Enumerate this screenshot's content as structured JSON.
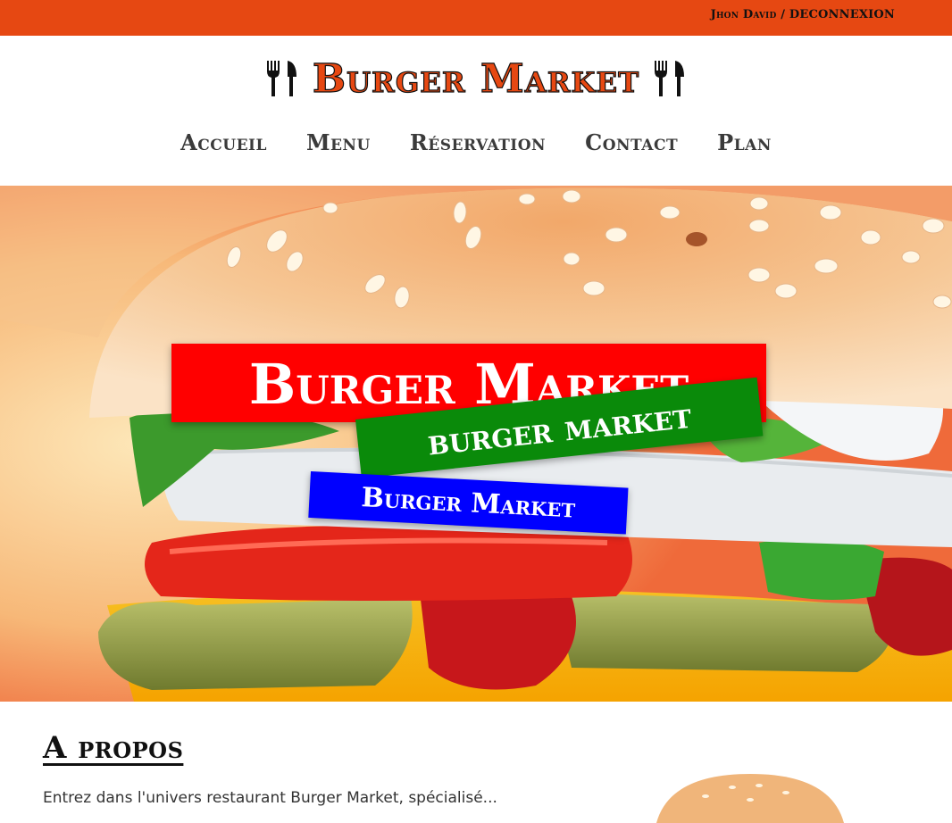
{
  "topbar": {
    "user_name": "Jhon David",
    "separator": " / ",
    "logout_label": "DECONNEXION",
    "color": "#e64812"
  },
  "header": {
    "logo_text": "Burger Market",
    "logo_icon": "cutlery-icon",
    "nav": [
      "Accueil",
      "Menu",
      "Réservation",
      "Contact",
      "Plan"
    ]
  },
  "hero": {
    "banners": [
      {
        "text": "Burger Market",
        "color": "#ff0000"
      },
      {
        "text": "burger market",
        "color": "#0a8a0a"
      },
      {
        "text": "Burger Market",
        "color": "#0000ff"
      }
    ]
  },
  "about": {
    "title": "A propos",
    "text": "Entrez dans l'univers restaurant Burger Market, spécialisé..."
  }
}
